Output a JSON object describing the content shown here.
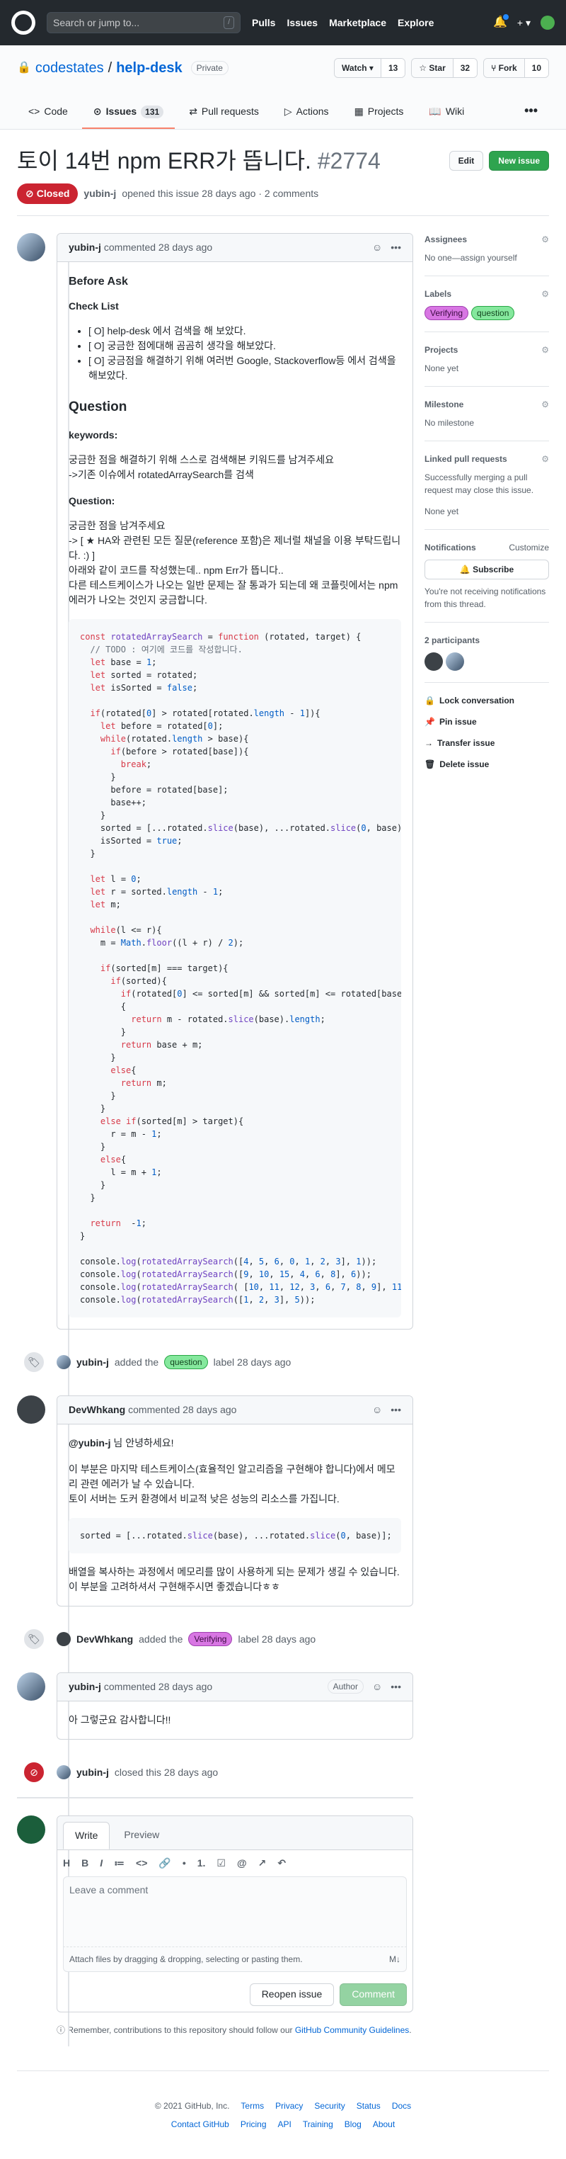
{
  "topbar": {
    "search_placeholder": "Search or jump to...",
    "search_key": "/",
    "nav": [
      "Pulls",
      "Issues",
      "Marketplace",
      "Explore"
    ],
    "plus": "+ ▾"
  },
  "repo": {
    "owner": "codestates",
    "sep": "/",
    "name": "help-desk",
    "visibility": "Private",
    "watch": "Watch ▾",
    "watch_count": "13",
    "star": "☆ Star",
    "star_count": "32",
    "fork": "⑂ Fork",
    "fork_count": "10"
  },
  "tabs": [
    {
      "icon": "<>",
      "label": "Code"
    },
    {
      "icon": "⊙",
      "label": "Issues",
      "count": "131"
    },
    {
      "icon": "⇄",
      "label": "Pull requests"
    },
    {
      "icon": "▷",
      "label": "Actions"
    },
    {
      "icon": "▦",
      "label": "Projects"
    },
    {
      "icon": "📖",
      "label": "Wiki"
    }
  ],
  "more": "•••",
  "issue": {
    "title": "토이 14번 npm ERR가 뜹니다.",
    "number": "#2774",
    "edit": "Edit",
    "new_issue": "New issue",
    "state": "Closed",
    "author": "yubin-j",
    "opened_text": "opened this issue 28 days ago · 2 comments"
  },
  "c1": {
    "author": "yubin-j",
    "time": "commented 28 days ago",
    "h_before": "Before Ask",
    "h_check": "Check List",
    "checks": [
      "[ O] help-desk 에서 검색을 해 보았다.",
      "[ O] 궁금한 점에대해 곰곰히 생각을 해보았다.",
      "[ O] 궁금점을 해결하기 위해 여러번 Google, Stackoverflow등 에서 검색을 해보았다."
    ],
    "h_question": "Question",
    "h_keywords": "keywords:",
    "kw1": "궁금한 점을 해결하기 위해 스스로 검색해본 키워드를 남겨주세요",
    "kw2": "->기존 이슈에서 rotatedArraySearch를 검색",
    "h_q": "Question:",
    "q1": "궁금한 점을 남겨주세요",
    "q2": "-> [ ★ HA와 관련된 모든 질문(reference 포함)은 제너럴 채널을 이용 부탁드립니다. :) ]",
    "q3": "아래와 같이 코드를 작성했는데.. npm Err가 뜹니다..",
    "q4": "다른 테스트케이스가 나오는 일반 문제는 잘 통과가 되는데 왜 코플릿에서는 npm 에러가 나오는 것인지 궁금합니다."
  },
  "e1": {
    "actor": "yubin-j",
    "pre": "added the",
    "label": "question",
    "post": "label 28 days ago"
  },
  "c2": {
    "author": "DevWhkang",
    "time": "commented 28 days ago",
    "mention": "@yubin-j",
    "p1": " 님 안녕하세요!",
    "p2": "이 부분은 마지막 테스트케이스(효율적인 알고리즘을 구현해야 합니다)에서 메모리 관련 에러가 날 수 있습니다.",
    "p3": "토이 서버는 도커 환경에서 비교적 낮은 성능의 리소스를 가집니다.",
    "p4": "배열을 복사하는 과정에서 메모리를 많이 사용하게 되는 문제가 생길 수 있습니다.",
    "p5": "이 부분을 고려하셔서 구현해주시면 좋겠습니다ㅎㅎ"
  },
  "e2": {
    "actor": "DevWhkang",
    "pre": "added the",
    "label": "Verifying",
    "post": "label 28 days ago"
  },
  "c3": {
    "author": "yubin-j",
    "time": "commented 28 days ago",
    "role": "Author",
    "text": "아 그렇군요 감사합니다!!"
  },
  "e3": {
    "actor": "yubin-j",
    "text": "closed this 28 days ago"
  },
  "editor": {
    "write": "Write",
    "preview": "Preview",
    "placeholder": "Leave a comment",
    "attach": "Attach files by dragging & dropping, selecting or pasting them.",
    "md": "M↓",
    "reopen": "Reopen issue",
    "comment": "Comment",
    "tools": [
      "H",
      "B",
      "I",
      "≔",
      "<>",
      "🔗",
      "•",
      "1.",
      "☑",
      "@",
      "↗",
      "↶"
    ]
  },
  "note": {
    "pre": "Remember, contributions to this repository should follow our ",
    "link": "GitHub Community Guidelines",
    "post": "."
  },
  "sidebar": {
    "assignees": "Assignees",
    "assignees_val": "No one—assign yourself",
    "labels": "Labels",
    "labels_vals": [
      "Verifying",
      "question"
    ],
    "projects": "Projects",
    "projects_val": "None yet",
    "milestone": "Milestone",
    "milestone_val": "No milestone",
    "linked": "Linked pull requests",
    "linked_desc": "Successfully merging a pull request may close this issue.",
    "linked_val": "None yet",
    "notifications": "Notifications",
    "customize": "Customize",
    "subscribe": "🔔 Subscribe",
    "notif_desc": "You're not receiving notifications from this thread.",
    "participants": "2 participants",
    "lock": "Lock conversation",
    "pin": "Pin issue",
    "transfer": "Transfer issue",
    "delete": "Delete issue"
  },
  "footer": {
    "copy": "© 2021 GitHub, Inc.",
    "row1": [
      "Terms",
      "Privacy",
      "Security",
      "Status",
      "Docs"
    ],
    "row2": [
      "Contact GitHub",
      "Pricing",
      "API",
      "Training",
      "Blog",
      "About"
    ]
  },
  "colors": {
    "closed": "#cb2431",
    "green": "#2ea44f",
    "question": "#85e89d",
    "verifying": "#d876e3"
  }
}
